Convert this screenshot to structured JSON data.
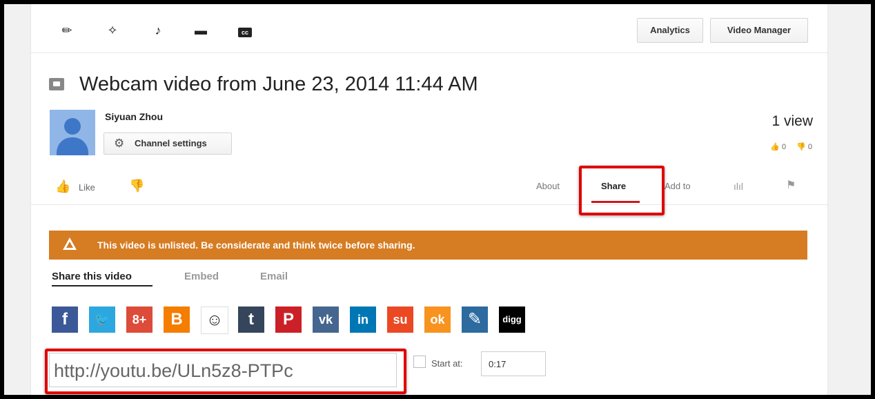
{
  "toolbar": {
    "tools": [
      "pencil-icon",
      "magic-wand-icon",
      "music-note-icon",
      "comment-icon",
      "cc-icon"
    ],
    "cc_label": "cc",
    "analytics_label": "Analytics",
    "video_manager_label": "Video Manager"
  },
  "video": {
    "title": "Webcam video from June 23, 2014 11:44 AM",
    "owner": "Siyuan Zhou",
    "channel_settings_label": "Channel settings",
    "views": "1 view",
    "likes_count": "0",
    "dislikes_count": "0"
  },
  "actions": {
    "like_label": "Like",
    "tabs": [
      "About",
      "Share",
      "Add to"
    ]
  },
  "share": {
    "warning": "This video is unlisted. Be considerate and think twice before sharing.",
    "subtabs": [
      "Share this video",
      "Embed",
      "Email"
    ],
    "url": "http://youtu.be/ULn5z8-PTPc",
    "start_at_label": "Start at:",
    "start_at_value": "0:17",
    "social": [
      {
        "name": "facebook",
        "glyph": "f",
        "color": "#3b5998"
      },
      {
        "name": "twitter",
        "glyph": "🐦",
        "color": "#2ca7e0"
      },
      {
        "name": "google-plus",
        "glyph": "8+",
        "color": "#dd4b39"
      },
      {
        "name": "blogger",
        "glyph": "B",
        "color": "#f57d00"
      },
      {
        "name": "reddit",
        "glyph": "☺",
        "color": "#ffffff"
      },
      {
        "name": "tumblr",
        "glyph": "t",
        "color": "#35465c"
      },
      {
        "name": "pinterest",
        "glyph": "P",
        "color": "#cb2027"
      },
      {
        "name": "vk",
        "glyph": "vk",
        "color": "#45668e"
      },
      {
        "name": "linkedin",
        "glyph": "in",
        "color": "#0077b5"
      },
      {
        "name": "stumbleupon",
        "glyph": "su",
        "color": "#eb4924"
      },
      {
        "name": "odnoklassniki",
        "glyph": "ok",
        "color": "#f7931e"
      },
      {
        "name": "livejournal",
        "glyph": "✎",
        "color": "#2d6aa0"
      },
      {
        "name": "digg",
        "glyph": "digg",
        "color": "#000000"
      }
    ]
  },
  "colors": {
    "warning_bg": "#d67c22",
    "highlight_red": "#e00000",
    "tab_underline": "#cc181e"
  }
}
